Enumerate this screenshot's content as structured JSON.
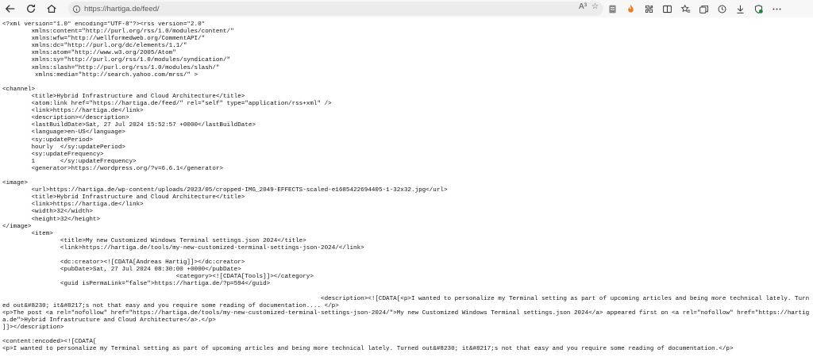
{
  "browser": {
    "url": "https://hartiga.de/feed/",
    "icons": {
      "back": "back-arrow-icon",
      "refresh": "refresh-icon",
      "home": "home-icon",
      "info": "info-icon",
      "read_aloud": "read-aloud-icon",
      "favorite": "star-icon",
      "reader": "reader-icon",
      "extension": "flame-extension-icon",
      "puzzle": "extensions-icon",
      "split": "split-screen-icon",
      "favorites": "favorites-icon",
      "collections": "collections-icon",
      "history": "history-icon",
      "downloads": "download-icon",
      "browser_essentials": "browser-essentials-icon",
      "menu": "more-icon"
    },
    "read_aloud_label": "A³"
  },
  "feed_source": "<?xml version=\"1.0\" encoding=\"UTF-8\"?><rss version=\"2.0\"\n\txmlns:content=\"http://purl.org/rss/1.0/modules/content/\"\n\txmlns:wfw=\"http://wellformedweb.org/CommentAPI/\"\n\txmlns:dc=\"http://purl.org/dc/elements/1.1/\"\n\txmlns:atom=\"http://www.w3.org/2005/Atom\"\n\txmlns:sy=\"http://purl.org/rss/1.0/modules/syndication/\"\n\txmlns:slash=\"http://purl.org/rss/1.0/modules/slash/\"\n\t xmlns:media=\"http://search.yahoo.com/mrss/\" >\n\n<channel>\n\t<title>Hybrid Infrastructure and Cloud Architecture</title>\n\t<atom:link href=\"https://hartiga.de/feed/\" rel=\"self\" type=\"application/rss+xml\" />\n\t<link>https://hartiga.de</link>\n\t<description></description>\n\t<lastBuildDate>Sat, 27 Jul 2024 15:52:57 +0000</lastBuildDate>\n\t<language>en-US</language>\n\t<sy:updatePeriod>\n\thourly\t</sy:updatePeriod>\n\t<sy:updateFrequency>\n\t1\t</sy:updateFrequency>\n\t<generator>https://wordpress.org/?v=6.6.1</generator>\n\n<image>\n\t<url>https://hartiga.de/wp-content/uploads/2023/05/cropped-IMG_2049-EFFECTS-scaled-e1685422694405-1-32x32.jpg</url>\n\t<title>Hybrid Infrastructure and Cloud Architecture</title>\n\t<link>https://hartiga.de</link>\n\t<width>32</width>\n\t<height>32</height>\n</image>\n\t<item>\n\t\t<title>My new Customized Windows Terminal settings.json 2024</title>\n\t\t<link>https://hartiga.de/tools/my-new-customized-terminal-settings-json-2024/</link>\n\n\t\t<dc:creator><![CDATA[Andreas Hartig]]></dc:creator>\n\t\t<pubDate>Sat, 27 Jul 2024 08:30:00 +0000</pubDate>\n\t\t\t\t\t\t<category><![CDATA[Tools]]></category>\n\t\t<guid isPermaLink=\"false\">https://hartiga.de/?p=594</guid>\n\n\t\t\t\t\t\t\t\t\t\t\t<description><![CDATA[<p>I wanted to personalize my Terminal setting as part of upcoming articles and being more technical lately. Turned out&#8230; it&#8217;s not that easy and you require some reading of documentation.... </p>\n<p>The post <a rel=\"nofollow\" href=\"https://hartiga.de/tools/my-new-customized-terminal-settings-json-2024/\">My new Customized Windows Terminal settings.json 2024</a> appeared first on <a rel=\"nofollow\" href=\"https://hartiga.de\">Hybrid Infrastructure and Cloud Architecture</a>.</p>\n]]></description>\n\t\t\t\t\t\t\t\t\t\t\t\t\t\t\t\t\t\t\t\t\t\t\t\t\t\t\t\t\t\t\t\t\t\t\t\t\t\t\t\t\t<content:encoded><![CDATA[\n<p>I wanted to personalize my Terminal setting as part of upcoming articles and being more technical lately. Turned out&#8230; it&#8217;s not that easy and you require some reading of documentation.</p>"
}
